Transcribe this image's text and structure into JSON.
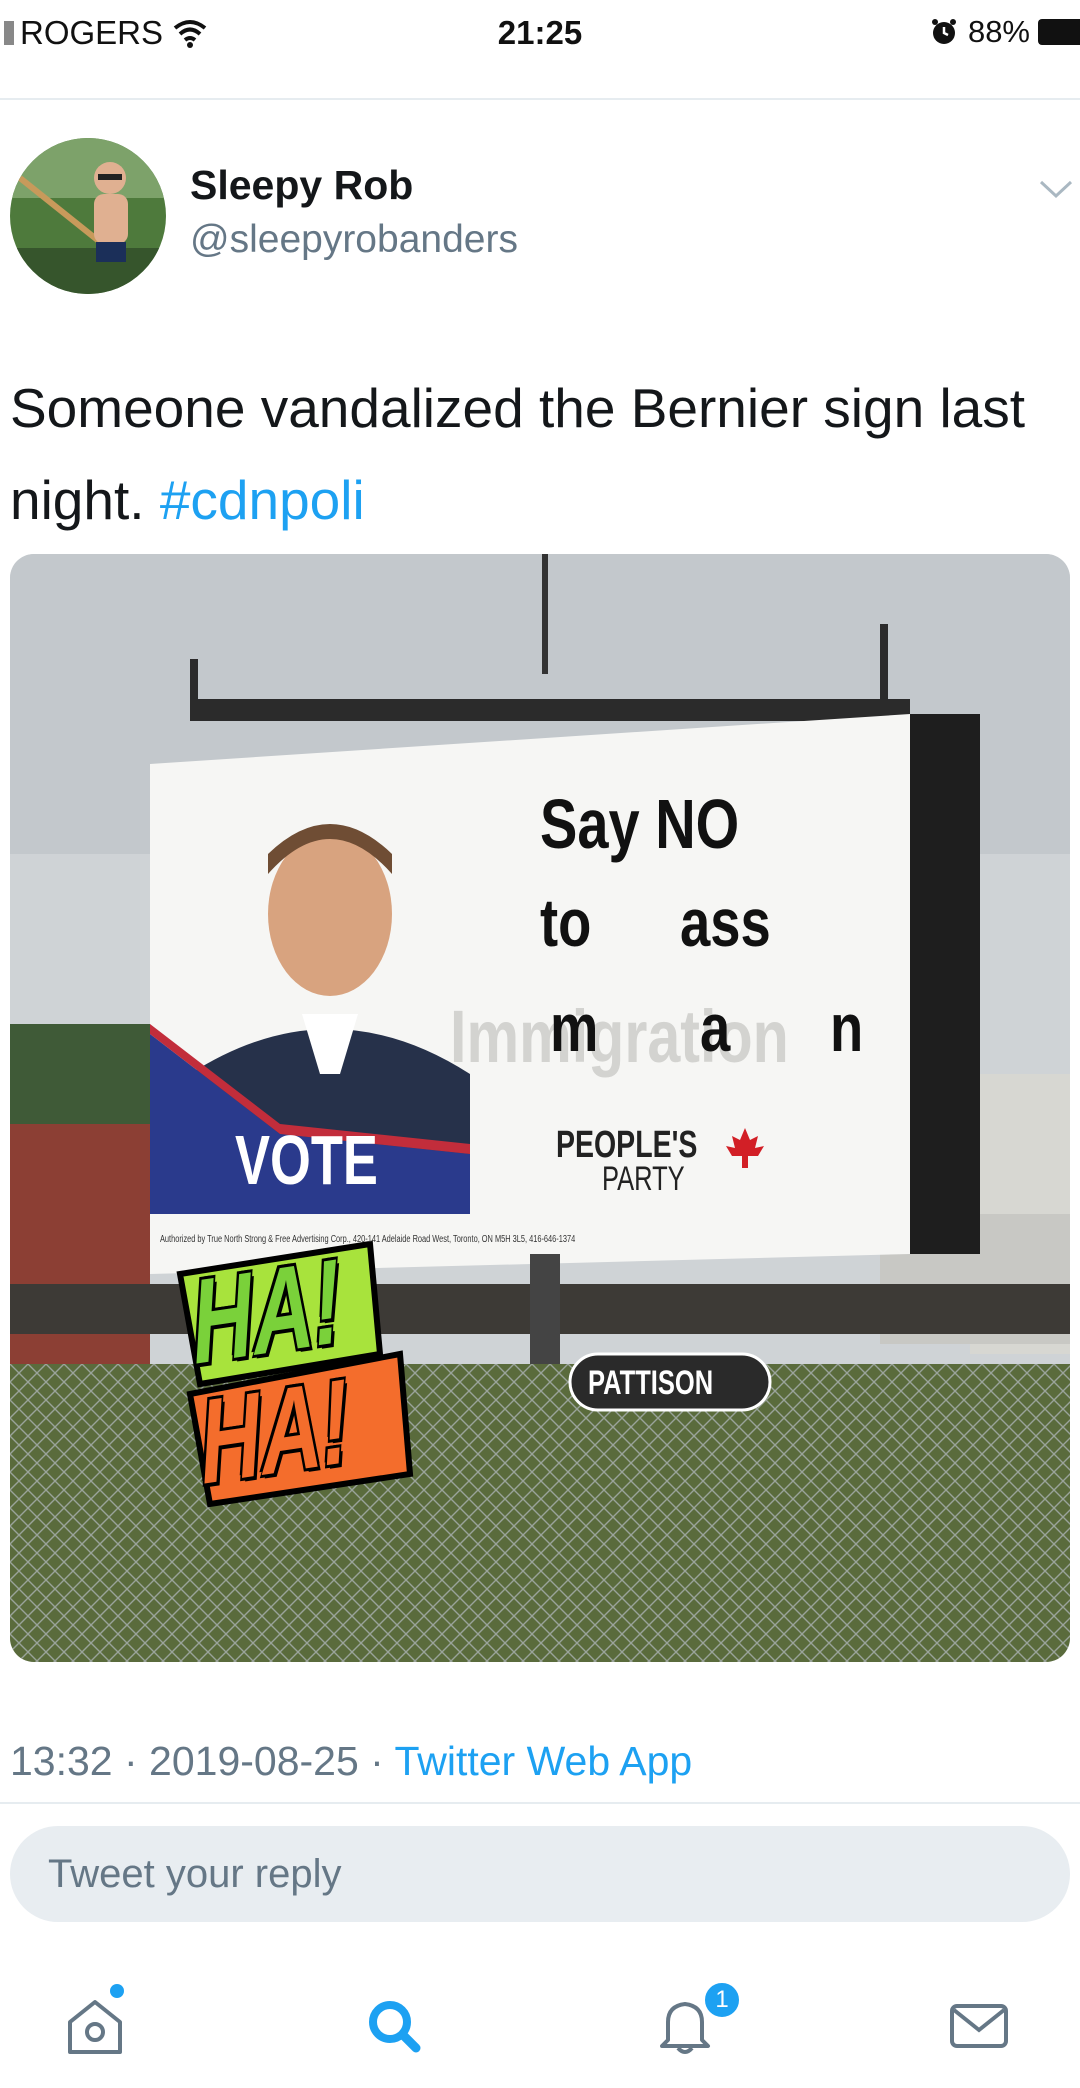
{
  "status_bar": {
    "carrier": "ROGERS",
    "time": "21:25",
    "battery": "88%"
  },
  "tweet": {
    "display_name": "Sleepy Rob",
    "handle": "@sleepyrobanders",
    "text_main": "Someone vandalized the Bernier sign last night. ",
    "hashtag": "#cdnpoli",
    "timestamp": "13:32 · 2019-08-25 · ",
    "client": "Twitter Web App"
  },
  "billboard": {
    "line1": "Say NO",
    "line2_a": "to",
    "line2_b": "ass",
    "line3_a": "m",
    "line3_b": "a",
    "line3_c": "n",
    "faded_word": "Immigration",
    "vote_label": "VOTE",
    "party_line1": "PEOPLE'S",
    "party_line2": "PARTY",
    "fine_print": "Authorized by True North Strong & Free Advertising Corp., 420-141 Adelaide Road West, Toronto, ON M5H 3L5, 416-646-1374",
    "pattison_label": "PATTISON",
    "sticker_ha1": "HA!",
    "sticker_ha2": "HA!"
  },
  "reply": {
    "placeholder": "Tweet your reply"
  },
  "tab_bar": {
    "notification_count": "1",
    "icons": [
      "home-icon",
      "search-icon",
      "bell-icon",
      "mail-icon"
    ]
  },
  "colors": {
    "accent": "#1da1f2",
    "secondary_text": "#657786",
    "primary_text": "#14171a"
  }
}
